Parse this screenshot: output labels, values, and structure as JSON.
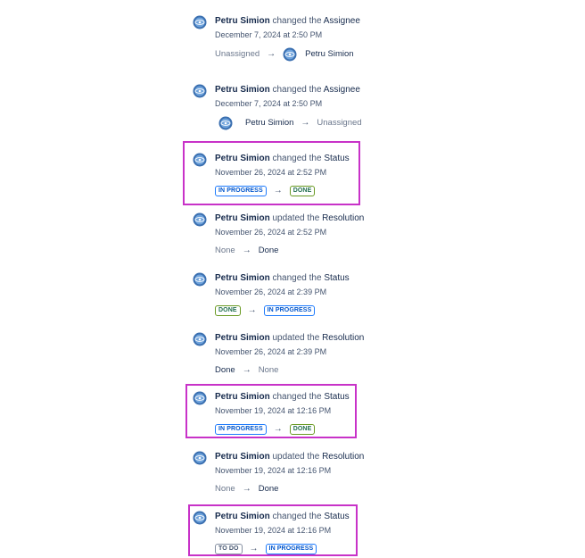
{
  "entries": [
    {
      "actor": "Petru Simion",
      "verb": "changed the",
      "field": "Assignee",
      "timestamp": "December 7, 2024 at 2:50 PM",
      "from": "Unassigned",
      "to": "Petru Simion"
    },
    {
      "actor": "Petru Simion",
      "verb": "changed the",
      "field": "Assignee",
      "timestamp": "December 7, 2024 at 2:50 PM",
      "from": "Petru Simion",
      "to": "Unassigned"
    },
    {
      "actor": "Petru Simion",
      "verb": "changed the",
      "field": "Status",
      "timestamp": "November 26, 2024 at 2:52 PM",
      "from": "IN PROGRESS",
      "to": "DONE"
    },
    {
      "actor": "Petru Simion",
      "verb": "updated the",
      "field": "Resolution",
      "timestamp": "November 26, 2024 at 2:52 PM",
      "from": "None",
      "to": "Done"
    },
    {
      "actor": "Petru Simion",
      "verb": "changed the",
      "field": "Status",
      "timestamp": "November 26, 2024 at 2:39 PM",
      "from": "DONE",
      "to": "IN PROGRESS"
    },
    {
      "actor": "Petru Simion",
      "verb": "updated the",
      "field": "Resolution",
      "timestamp": "November 26, 2024 at 2:39 PM",
      "from": "Done",
      "to": "None"
    },
    {
      "actor": "Petru Simion",
      "verb": "changed the",
      "field": "Status",
      "timestamp": "November 19, 2024 at 12:16 PM",
      "from": "IN PROGRESS",
      "to": "DONE"
    },
    {
      "actor": "Petru Simion",
      "verb": "updated the",
      "field": "Resolution",
      "timestamp": "November 19, 2024 at 12:16 PM",
      "from": "None",
      "to": "Done"
    },
    {
      "actor": "Petru Simion",
      "verb": "changed the",
      "field": "Status",
      "timestamp": "November 19, 2024 at 12:16 PM",
      "from": "TO DO",
      "to": "IN PROGRESS"
    }
  ],
  "icons": {
    "arrow": "arrow-right-icon",
    "avatar": "user-avatar-icon"
  },
  "colors": {
    "highlight": "#c832c8",
    "in_progress": "#1d7afc",
    "done": "#6a9a23",
    "todo": "#8590a2"
  }
}
